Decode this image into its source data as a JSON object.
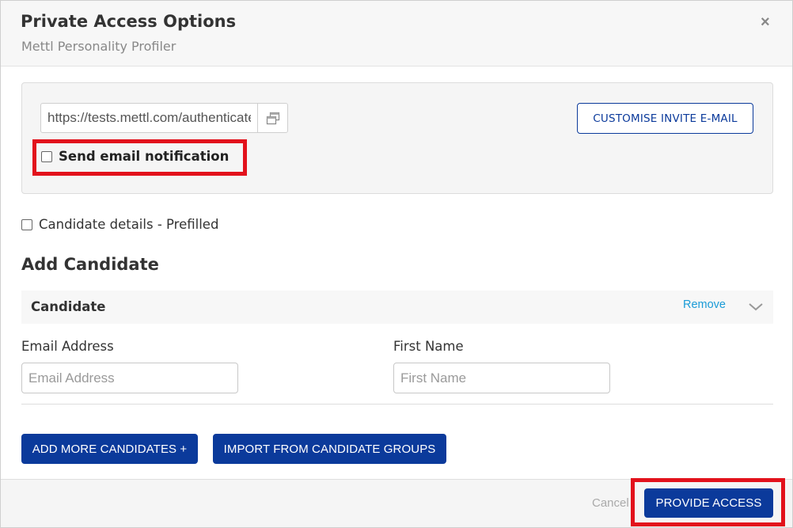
{
  "dialog": {
    "title": "Private Access Options",
    "subtitle": "Mettl Personality Profiler",
    "close_glyph": "×"
  },
  "link_panel": {
    "url_value": "https://tests.mettl.com/authenticateKey/",
    "copy_icon": "copy-icon",
    "customise_label": "CUSTOMISE INVITE E-MAIL",
    "send_email_label": "Send email notification",
    "send_email_checked": false
  },
  "prefill": {
    "label": "Candidate details - Prefilled",
    "checked": false
  },
  "add_candidate": {
    "heading": "Add Candidate",
    "candidate_title": "Candidate",
    "remove_label": "Remove",
    "email_label": "Email Address",
    "email_placeholder": "Email Address",
    "first_name_label": "First Name",
    "first_name_placeholder": "First Name"
  },
  "actions": {
    "add_more_label": "ADD MORE CANDIDATES +",
    "import_label": "IMPORT FROM CANDIDATE GROUPS"
  },
  "footer": {
    "cancel_label": "Cancel",
    "provide_label": "PROVIDE ACCESS"
  },
  "colors": {
    "primary": "#0b3a9b",
    "link": "#1a9bd7",
    "highlight": "#e2121c"
  }
}
